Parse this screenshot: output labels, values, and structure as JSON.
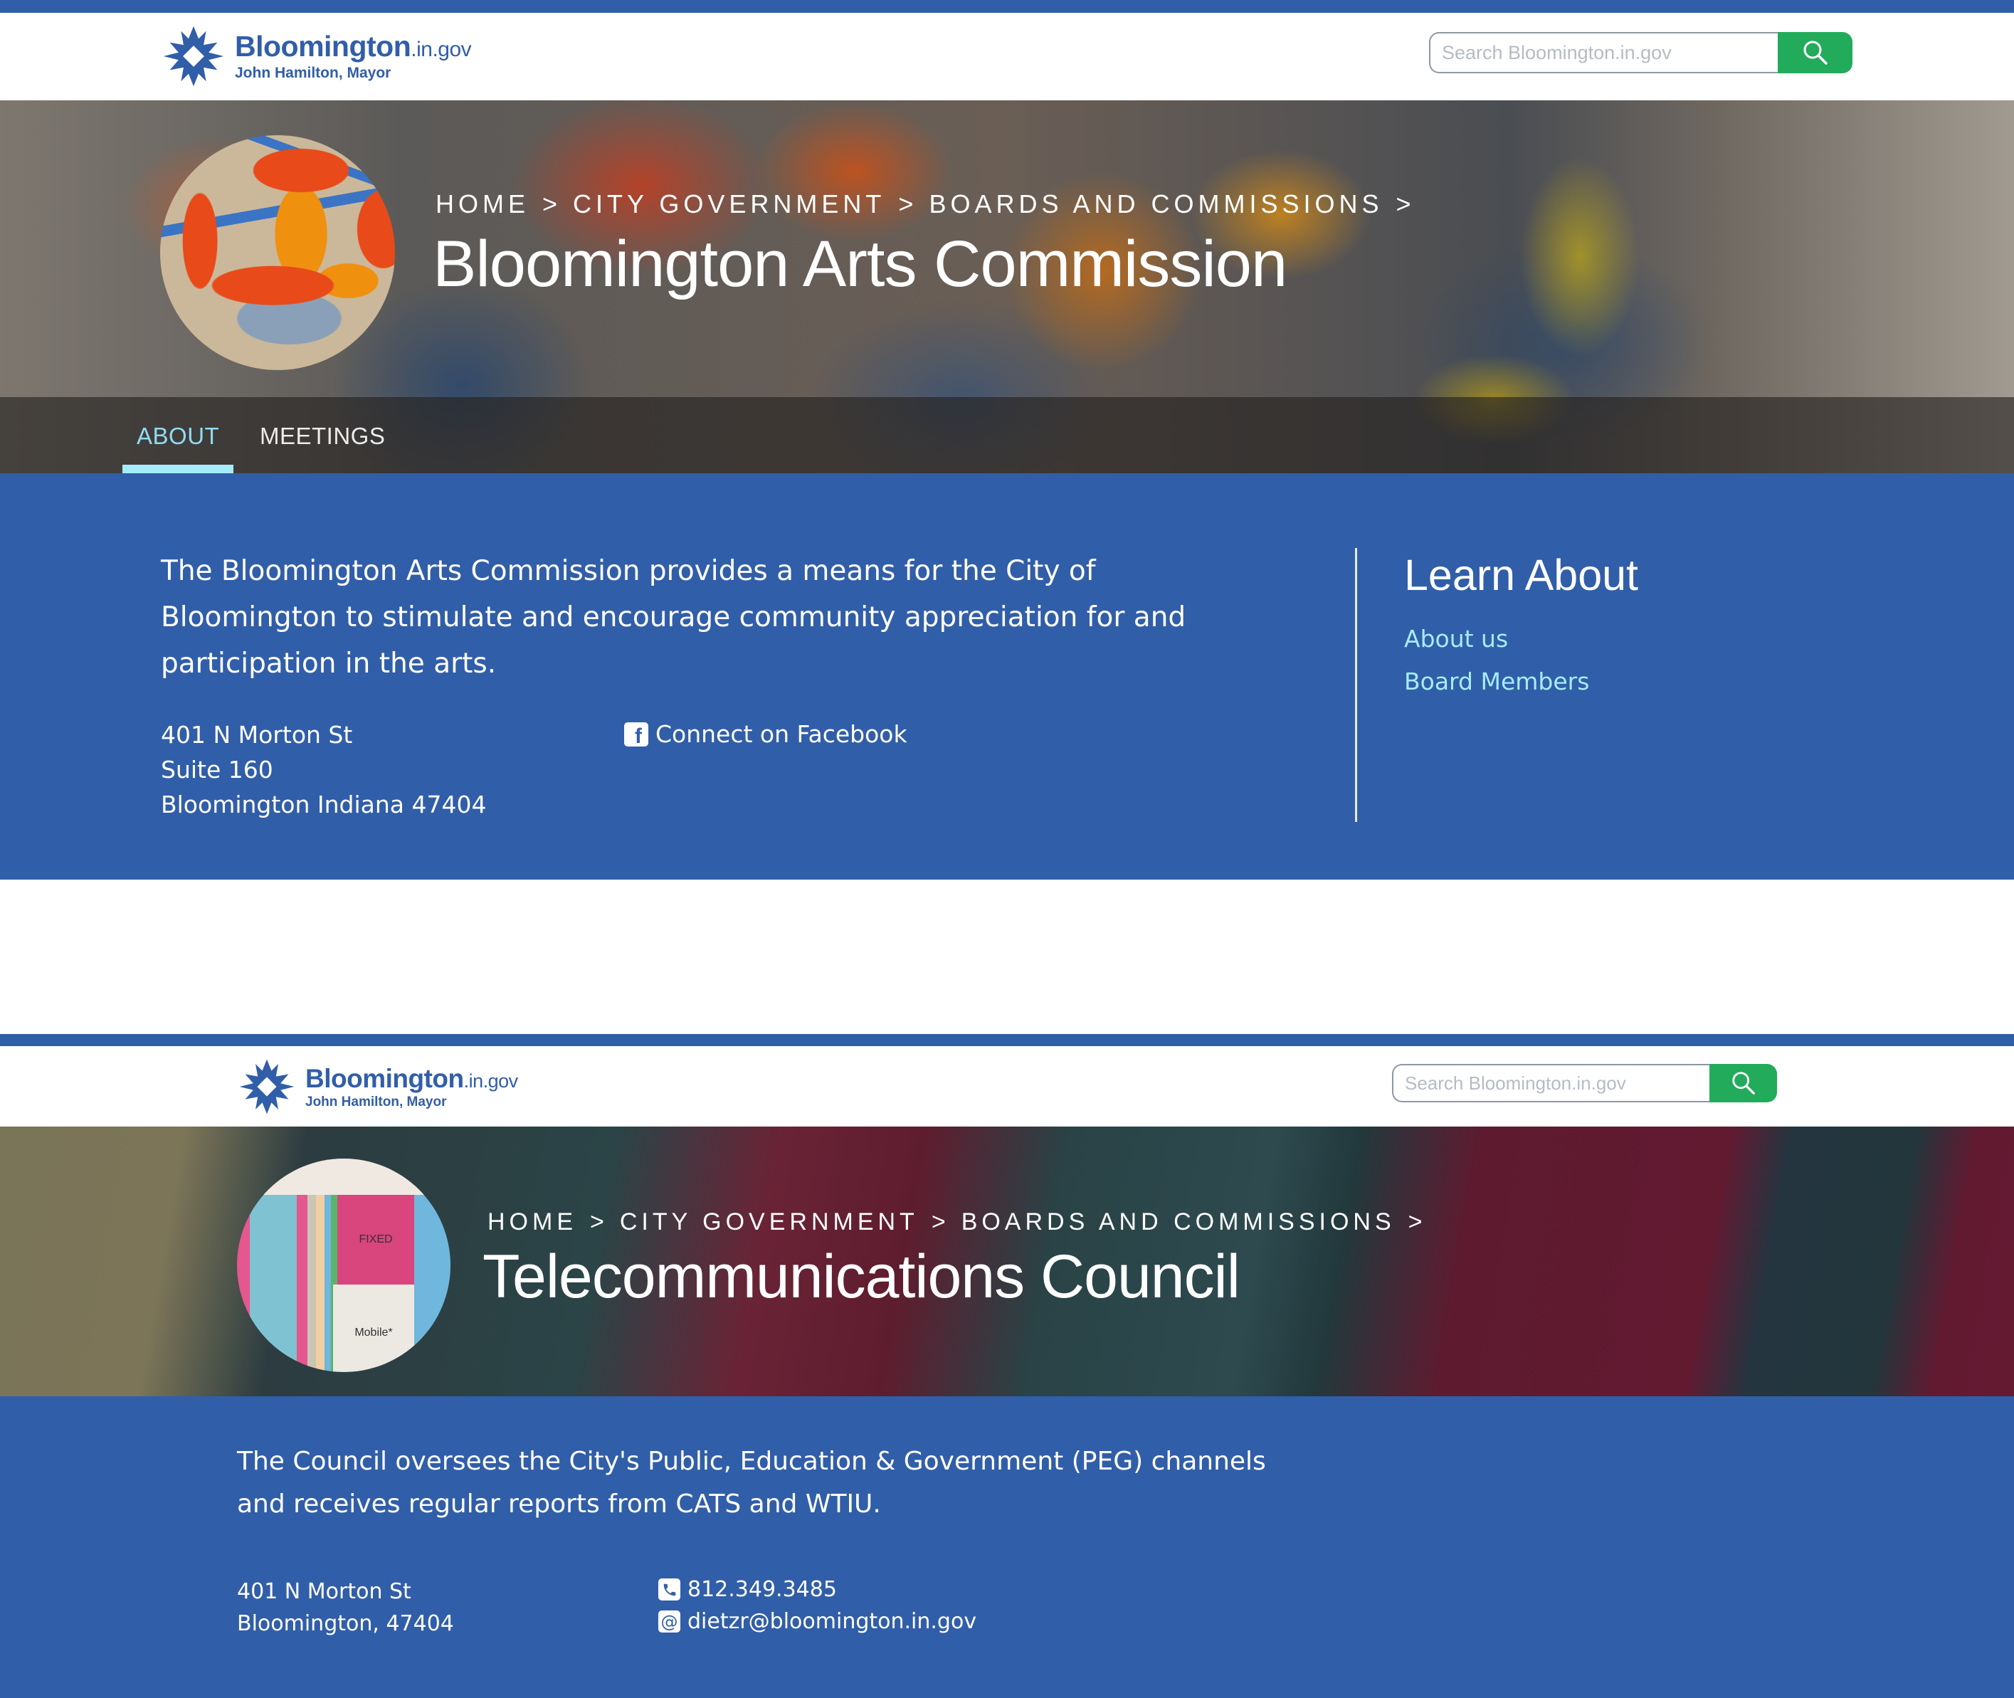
{
  "pages": [
    {
      "site": {
        "logo_name": "Bloomington",
        "logo_domain": ".in.gov",
        "logo_subtitle": "John Hamilton, Mayor"
      },
      "search": {
        "placeholder": "Search Bloomington.in.gov",
        "button_icon": "search-icon"
      },
      "breadcrumb": [
        {
          "label": "HOME"
        },
        {
          "label": "CITY GOVERNMENT"
        },
        {
          "label": "BOARDS AND COMMISSIONS"
        }
      ],
      "breadcrumb_separator": ">",
      "title": "Bloomington Arts Commission",
      "tabs": [
        {
          "label": "ABOUT",
          "active": true
        },
        {
          "label": "MEETINGS",
          "active": false
        }
      ],
      "description": "The Bloomington Arts Commission provides a means for the City of Bloomington to stimulate and encourage community appreciation for and participation in the arts.",
      "address": [
        "401 N Morton St",
        "Suite 160",
        "Bloomington Indiana 47404"
      ],
      "contacts": [
        {
          "icon": "facebook-icon",
          "label": "Connect on Facebook"
        }
      ],
      "learn_about": {
        "title": "Learn About",
        "links": [
          {
            "label": "About us"
          },
          {
            "label": "Board Members"
          }
        ]
      }
    },
    {
      "site": {
        "logo_name": "Bloomington",
        "logo_domain": ".in.gov",
        "logo_subtitle": "John Hamilton, Mayor"
      },
      "search": {
        "placeholder": "Search Bloomington.in.gov",
        "button_icon": "search-icon"
      },
      "breadcrumb": [
        {
          "label": "HOME"
        },
        {
          "label": "CITY GOVERNMENT"
        },
        {
          "label": "BOARDS AND COMMISSIONS"
        }
      ],
      "breadcrumb_separator": ">",
      "title": "Telecommunications Council",
      "emblem_labels": {
        "fixed": "FIXED",
        "mobile": "Mobile*"
      },
      "description": "The Council oversees the City's Public, Education & Government (PEG) channels and receives regular reports from CATS and WTIU.",
      "address": [
        "401 N Morton St",
        "Bloomington, 47404"
      ],
      "contacts": [
        {
          "icon": "phone-icon",
          "label": "812.349.3485"
        },
        {
          "icon": "email-icon",
          "label": "dietzr@bloomington.in.gov"
        }
      ]
    }
  ],
  "colors": {
    "brand_blue": "#315ea8",
    "search_green": "#22ab5a",
    "link_cyan": "#a5ecfa",
    "tab_active": "#8fdcf2"
  }
}
